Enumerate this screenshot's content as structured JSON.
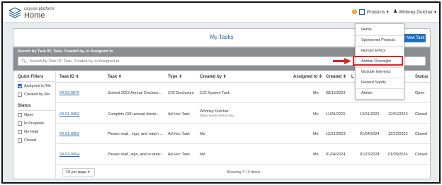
{
  "header": {
    "brand_small": "cayuse platform",
    "brand_big": "Home",
    "notification_count": "1",
    "products_label": "Products ▾",
    "user_label": "Whitney Dutcher ▾"
  },
  "panel": {
    "title": "My Tasks",
    "new_task_label": "+ New Task"
  },
  "search": {
    "label": "Search by Task ID, Task, Created by, or Assigned to",
    "placeholder": "Search by Task ID, Task, Created by, or Assigned to"
  },
  "quick_filters": {
    "title": "Quick Filters",
    "items": [
      {
        "label": "Assigned to Me",
        "checked": true
      },
      {
        "label": "Created by Me",
        "checked": false
      }
    ],
    "status_title": "Status",
    "status_items": [
      {
        "label": "Open"
      },
      {
        "label": "In Progress"
      },
      {
        "label": "On Hold"
      },
      {
        "label": "Closed"
      }
    ]
  },
  "table": {
    "headers": {
      "task_id": "Task ID ⇕",
      "task": "Task ⇕",
      "type": "Type ⇕",
      "created_by": "Created by ⇕",
      "assigned_to": "Assigned to ⇕",
      "created": "Created ⇕",
      "l": "L",
      "status": "Status"
    },
    "rows": [
      {
        "id": "24-03-0076",
        "task": "Submit 2023 Annual Disclosu...",
        "type": "COI Disclosure",
        "created_by": "COI System Task",
        "created_by_sub": "",
        "assigned_to": "Me",
        "created": "08/15/2023",
        "col7": "",
        "col8": "",
        "status": "Open"
      },
      {
        "id": "24-01-0002",
        "task": "Complete COI annual disclo...",
        "type": "Ad Hoc Task",
        "created_by": "Whitney Dutcher",
        "created_by_sub": "hillary.snyder@ohio.edu",
        "assigned_to": "Me",
        "created": "11/29/2023",
        "col7": "12/01/2023",
        "col8": "12/01/2023",
        "status": "Closed"
      },
      {
        "id": "24-01-0003",
        "task": "Please read , sign, and return ...",
        "type": "Ad Hoc Task",
        "created_by": "Me",
        "created_by_sub": "",
        "assigned_to": "Me",
        "created": "12/21/2023",
        "col7": "01/04/2024",
        "col8": "12/22/2023",
        "status": "Closed"
      },
      {
        "id": "24-01-0004",
        "task": "Please read, sign, and re-attac...",
        "type": "Ad Hoc Task",
        "created_by": "Me",
        "created_by_sub": "",
        "assigned_to": "Me",
        "created": "01/04/2024",
        "col7": "01/23/2024",
        "col8": "01/05/2024",
        "status": "Closed"
      }
    ]
  },
  "footer": {
    "per_page": "10 per page ▾",
    "showing": "Showing 4 / 4 items"
  },
  "products_menu": {
    "items": [
      {
        "label": "Home"
      },
      {
        "label": "Sponsored Projects"
      },
      {
        "label": "Human Ethics"
      },
      {
        "label": "Animal Oversight"
      },
      {
        "label": "Outside Interests"
      },
      {
        "label": "Hazard Safety"
      },
      {
        "label": "Admin"
      }
    ]
  },
  "colors": {
    "accent": "#1f6fc0",
    "highlight": "#d9232a",
    "search_bar": "#8a8f94"
  }
}
